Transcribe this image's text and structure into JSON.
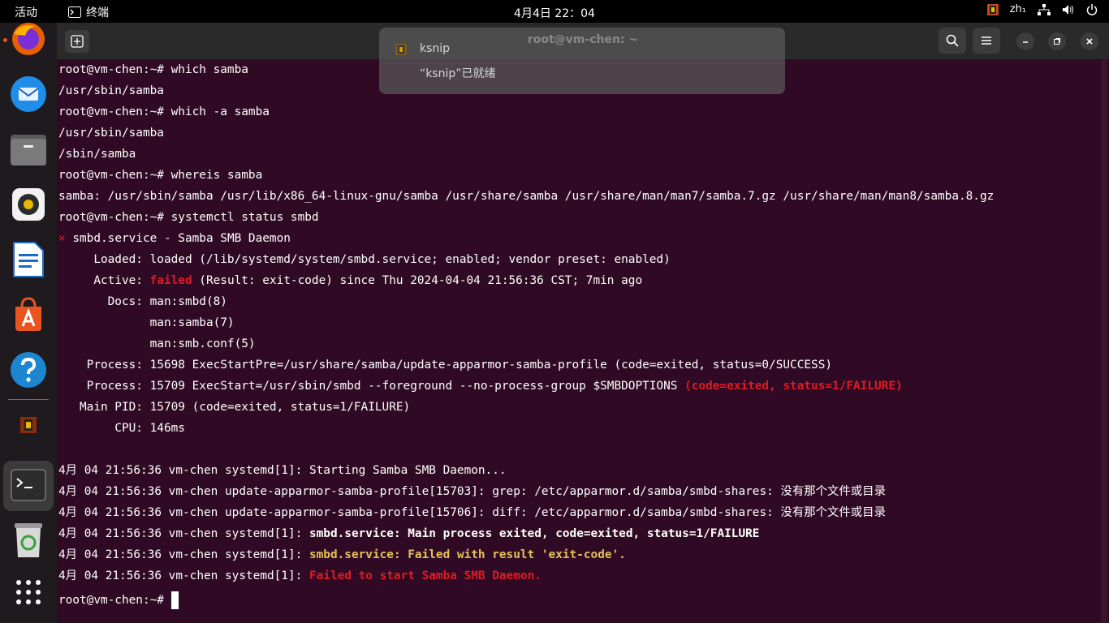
{
  "topbar": {
    "activities": "活动",
    "app_name": "终端",
    "clock": "4月4日  22：04",
    "input_method": "zh₁"
  },
  "window": {
    "title": "root@vm-chen: ~"
  },
  "notification": {
    "title": "ksnip",
    "body": "“ksnip”已就绪"
  },
  "terminal": {
    "lines": [
      {
        "top": "0",
        "parts": [
          {
            "text": "root@vm-chen:~# which samba"
          }
        ]
      },
      {
        "top": "26",
        "parts": [
          {
            "text": "/usr/sbin/samba"
          }
        ]
      },
      {
        "top": "52",
        "parts": [
          {
            "text": "root@vm-chen:~# which -a samba"
          }
        ]
      },
      {
        "top": "78",
        "parts": [
          {
            "text": "/usr/sbin/samba"
          }
        ]
      },
      {
        "top": "104",
        "parts": [
          {
            "text": "/sbin/samba"
          }
        ]
      },
      {
        "top": "130",
        "parts": [
          {
            "text": "root@vm-chen:~# whereis samba"
          }
        ]
      },
      {
        "top": "156",
        "parts": [
          {
            "text": "samba: /usr/sbin/samba /usr/lib/x86_64-linux-gnu/samba /usr/share/samba /usr/share/man/man7/samba.7.gz /usr/share/man/man8/samba.8.gz"
          }
        ]
      },
      {
        "top": "182",
        "parts": [
          {
            "text": "root@vm-chen:~# systemctl status smbd"
          }
        ]
      },
      {
        "top": "208",
        "parts": [
          {
            "text": "×",
            "cls": "red"
          },
          {
            "text": " smbd.service - Samba SMB Daemon"
          }
        ]
      },
      {
        "top": "234",
        "parts": [
          {
            "text": "     Loaded: loaded (/lib/systemd/system/smbd.service; enabled; vendor preset: enabled)"
          }
        ]
      },
      {
        "top": "260",
        "parts": [
          {
            "text": "     Active: "
          },
          {
            "text": "failed",
            "cls": "red bold"
          },
          {
            "text": " (Result: exit-code) since Thu 2024-04-04 21:56:36 CST; 7min ago"
          }
        ]
      },
      {
        "top": "286",
        "parts": [
          {
            "text": "       Docs: man:smbd(8)"
          }
        ]
      },
      {
        "top": "312",
        "parts": [
          {
            "text": "             man:samba(7)"
          }
        ]
      },
      {
        "top": "338",
        "parts": [
          {
            "text": "             man:smb.conf(5)"
          }
        ]
      },
      {
        "top": "364",
        "parts": [
          {
            "text": "    Process: 15698 ExecStartPre=/usr/share/samba/update-apparmor-samba-profile (code=exited, status=0/SUCCESS)"
          }
        ]
      },
      {
        "top": "390",
        "parts": [
          {
            "text": "    Process: 15709 ExecStart=/usr/sbin/smbd --foreground --no-process-group $SMBDOPTIONS "
          },
          {
            "text": "(code=exited, status=1/FAILURE)",
            "cls": "red bold"
          }
        ]
      },
      {
        "top": "416",
        "parts": [
          {
            "text": "   Main PID: 15709 (code=exited, status=1/FAILURE)"
          }
        ]
      },
      {
        "top": "442",
        "parts": [
          {
            "text": "        CPU: 146ms"
          }
        ]
      },
      {
        "top": "494",
        "parts": [
          {
            "text": "4月 04 21:56:36 vm-chen systemd[1]: Starting Samba SMB Daemon..."
          }
        ]
      },
      {
        "top": "520",
        "parts": [
          {
            "text": "4月 04 21:56:36 vm-chen update-apparmor-samba-profile[15703]: grep: /etc/apparmor.d/samba/smbd-shares: 没有那个文件或目录"
          }
        ]
      },
      {
        "top": "546",
        "parts": [
          {
            "text": "4月 04 21:56:36 vm-chen update-apparmor-samba-profile[15706]: diff: /etc/apparmor.d/samba/smbd-shares: 没有那个文件或目录"
          }
        ]
      },
      {
        "top": "572",
        "parts": [
          {
            "text": "4月 04 21:56:36 vm-chen systemd[1]: "
          },
          {
            "text": "smbd.service: Main process exited, code=exited, status=1/FAILURE",
            "cls": "bold"
          }
        ]
      },
      {
        "top": "598",
        "parts": [
          {
            "text": "4月 04 21:56:36 vm-chen systemd[1]: "
          },
          {
            "text": "smbd.service: Failed with result 'exit-code'.",
            "cls": "yellow bold"
          }
        ]
      },
      {
        "top": "624",
        "parts": [
          {
            "text": "4月 04 21:56:36 vm-chen systemd[1]: "
          },
          {
            "text": "Failed to start Samba SMB Daemon.",
            "cls": "red bold"
          }
        ]
      }
    ],
    "prompt": "root@vm-chen:~# "
  }
}
